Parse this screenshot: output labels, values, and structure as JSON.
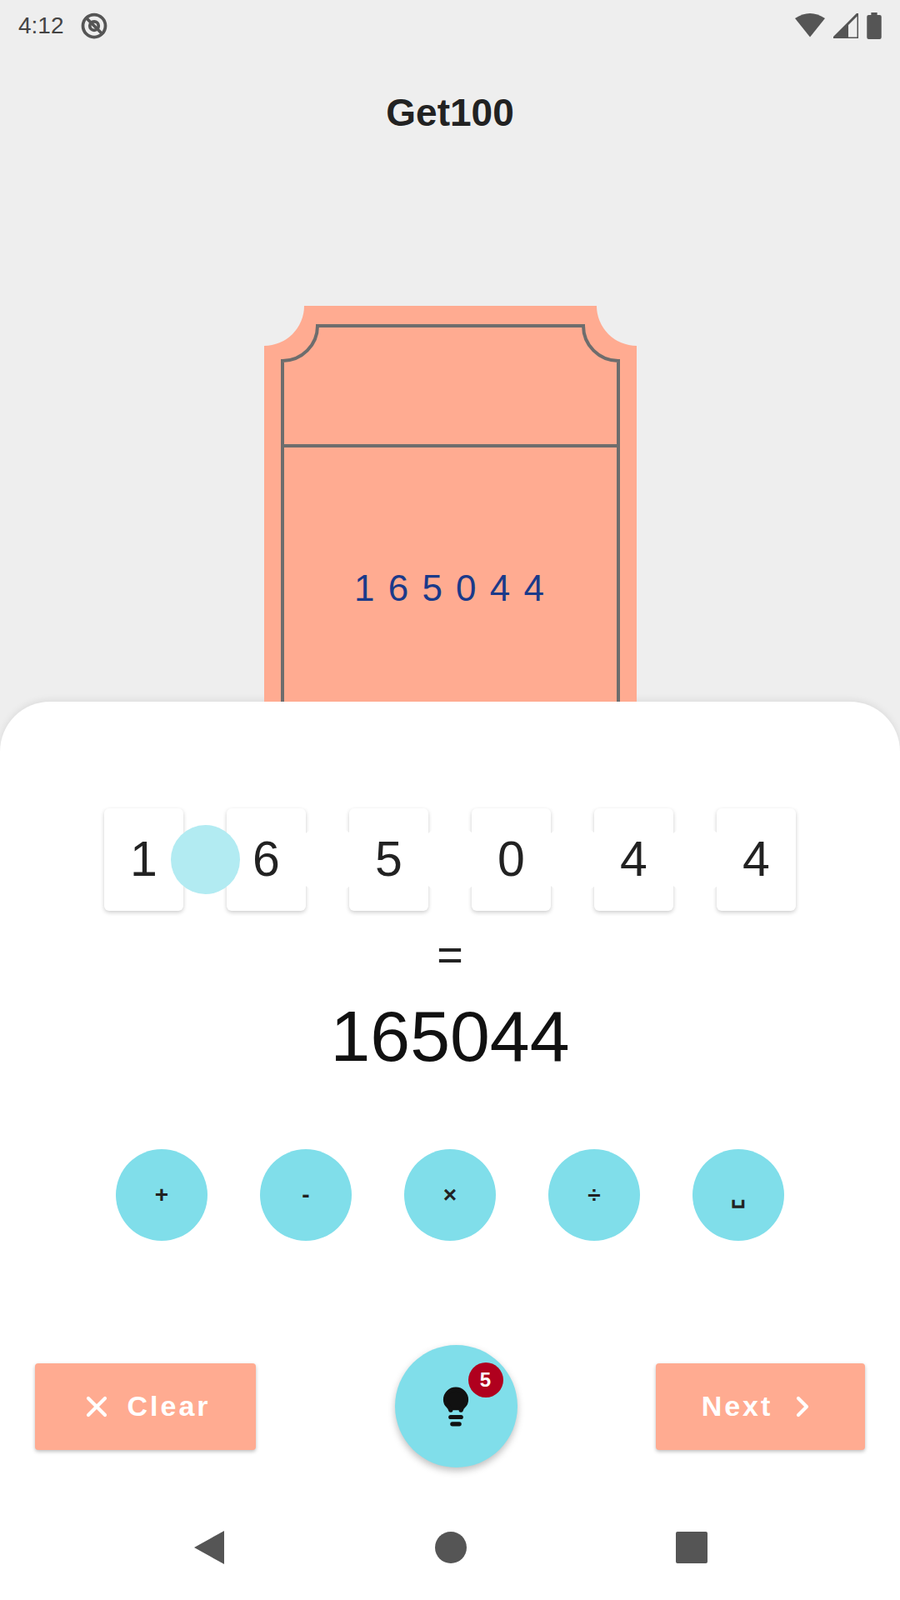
{
  "status_bar": {
    "time": "4:12"
  },
  "title": "Get100",
  "ticket": {
    "number": "1 6 5 0 4 4"
  },
  "puzzle": {
    "digits": [
      "1",
      "6",
      "5",
      "0",
      "4",
      "4"
    ],
    "slots": [
      {
        "selected": true
      },
      {
        "selected": false
      },
      {
        "selected": false
      },
      {
        "selected": false
      },
      {
        "selected": false
      }
    ],
    "equals": "=",
    "result": "165044"
  },
  "operators": [
    "+",
    "-",
    "×",
    "÷",
    "␣"
  ],
  "buttons": {
    "clear": "Clear",
    "next": "Next"
  },
  "hint": {
    "badge": "5"
  }
}
